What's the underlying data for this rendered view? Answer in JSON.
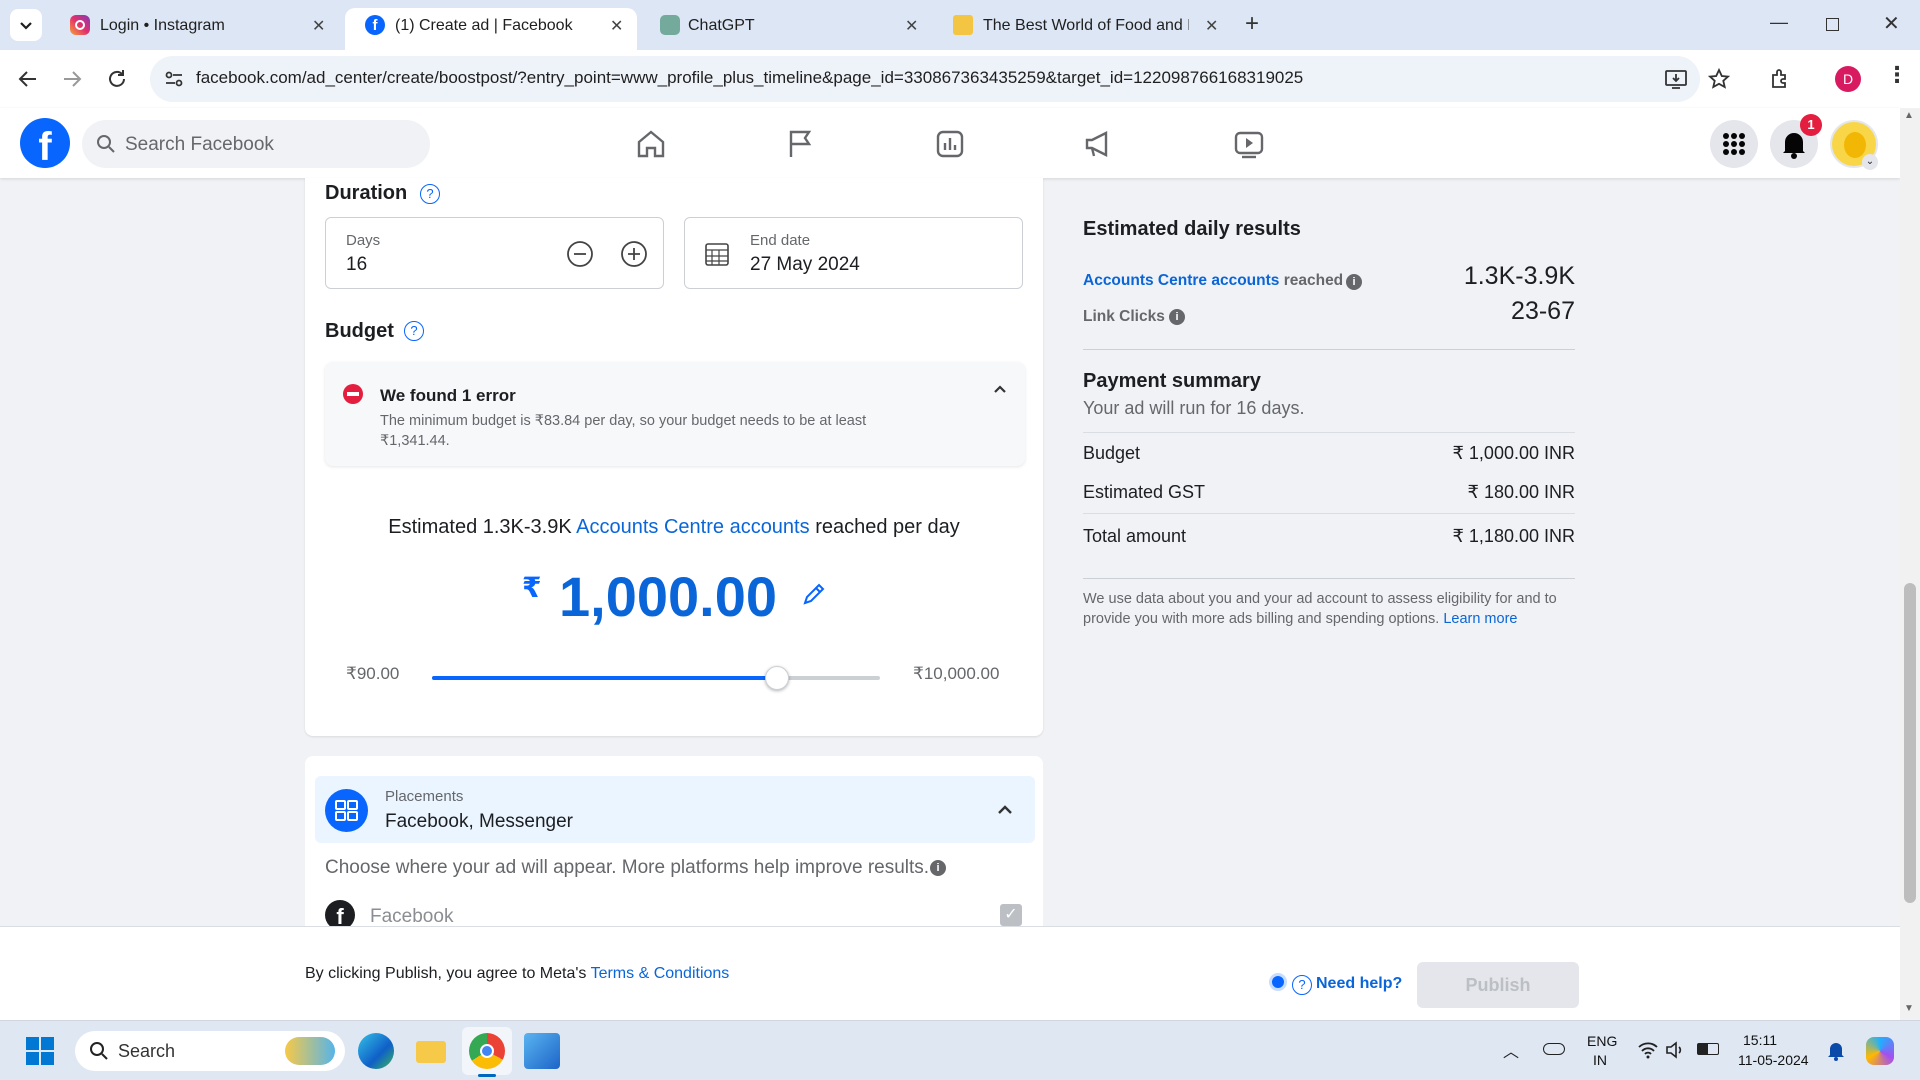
{
  "browser": {
    "tabs": [
      {
        "title": "Login • Instagram",
        "active": false
      },
      {
        "title": "(1) Create ad | Facebook",
        "active": true
      },
      {
        "title": "ChatGPT",
        "active": false
      },
      {
        "title": "The Best World of Food and Be",
        "active": false
      }
    ],
    "url": "facebook.com/ad_center/create/boostpost/?entry_point=www_profile_plus_timeline&page_id=330867363435259&target_id=122098766168319025",
    "profile_initial": "D"
  },
  "header": {
    "search_placeholder": "Search Facebook",
    "notification_count": "1"
  },
  "duration": {
    "title": "Duration",
    "days_label": "Days",
    "days_value": "16",
    "end_date_label": "End date",
    "end_date_value": "27 May 2024"
  },
  "budget": {
    "title": "Budget",
    "error_title": "We found 1 error",
    "error_text_line1": "The minimum budget is ₹83.84 per day, so your budget needs to be at least",
    "error_text_line2": "₹1,341.44.",
    "estimate_prefix": "Estimated 1.3K-3.9K",
    "estimate_link": "Accounts Centre accounts",
    "estimate_suffix": "reached per day",
    "currency_symbol": "₹",
    "amount": "1,000.00",
    "slider_min": "₹90.00",
    "slider_max": "₹10,000.00",
    "slider_fraction": 0.77
  },
  "placements": {
    "label": "Placements",
    "value": "Facebook, Messenger",
    "description": "Choose where your ad will appear. More platforms help improve results.",
    "facebook_label": "Facebook"
  },
  "estimated_results": {
    "title": "Estimated daily results",
    "reach_link": "Accounts Centre accounts",
    "reach_suffix": "reached",
    "reach_value": "1.3K-3.9K",
    "clicks_label": "Link Clicks",
    "clicks_value": "23-67"
  },
  "payment": {
    "title": "Payment summary",
    "subtitle": "Your ad will run for 16 days.",
    "budget_label": "Budget",
    "budget_value": "₹ 1,000.00 INR",
    "gst_label": "Estimated GST",
    "gst_value": "₹ 180.00 INR",
    "total_label": "Total amount",
    "total_value": "₹ 1,180.00 INR",
    "disclaimer_line1": "We use data about you and your ad account to assess eligibility for and to",
    "disclaimer_line2": "provide you with more ads billing and spending options.",
    "learn_more": "Learn more"
  },
  "footer": {
    "terms_prefix": "By clicking Publish, you agree to Meta's",
    "terms_link": "Terms & Conditions",
    "help": "Need help?",
    "publish": "Publish"
  },
  "taskbar": {
    "search": "Search",
    "lang_line1": "ENG",
    "lang_line2": "IN",
    "time": "15:11",
    "date": "11-05-2024"
  },
  "colors": {
    "facebook_blue": "#0866ff",
    "error_red": "#e41e3f",
    "tab_strip": "#dde6f5"
  }
}
